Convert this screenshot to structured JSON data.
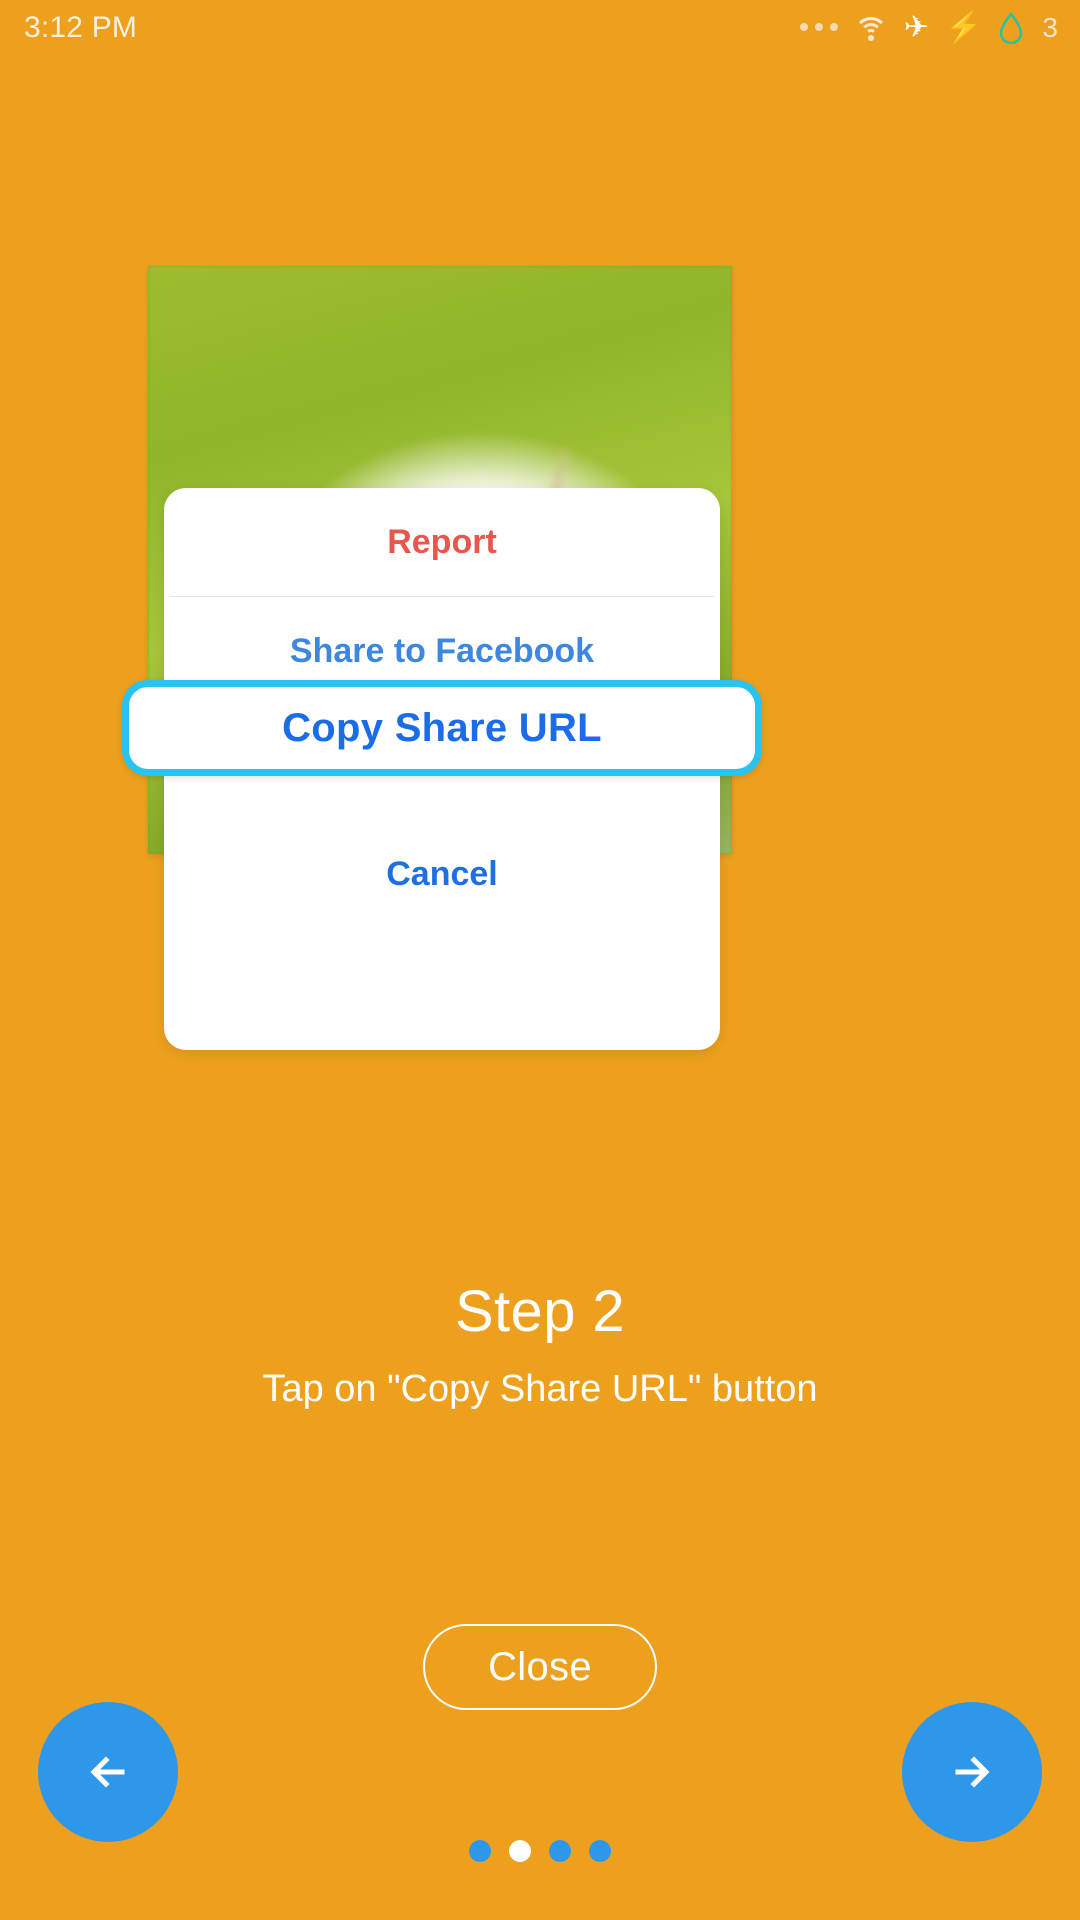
{
  "status_bar": {
    "time": "3:12 PM",
    "icons": [
      {
        "name": "more-icon",
        "glyph": "..."
      },
      {
        "name": "wifi-icon",
        "glyph": "wifi"
      },
      {
        "name": "airplane-mode-icon",
        "glyph": "✈"
      },
      {
        "name": "charging-bolt-icon",
        "glyph": "⚡"
      },
      {
        "name": "water-drop-icon",
        "glyph": "drop"
      }
    ],
    "badge_count": "3"
  },
  "action_sheet": {
    "items": [
      {
        "label": "Report",
        "color": "#e8574e",
        "highlighted": false
      },
      {
        "label": "Share to Facebook",
        "color": "#3d87e0",
        "highlighted": false
      },
      {
        "label": "Copy Share URL",
        "color": "#1b6ce8",
        "highlighted": true
      },
      {
        "label": "Cancel",
        "color": "#1e6fe0",
        "highlighted": false
      }
    ],
    "highlight_color": "#29c3f2"
  },
  "tutorial": {
    "step_title": "Step 2",
    "step_subtitle": "Tap on \"Copy Share URL\" button",
    "close_label": "Close"
  },
  "navigation": {
    "prev_label": "←",
    "next_label": "→",
    "dots_total": 4,
    "active_dot_index": 1
  },
  "colors": {
    "background": "#eda01e",
    "accent_blue": "#2f97ea",
    "highlight_cyan": "#29c3f2",
    "report_red": "#e8574e"
  }
}
